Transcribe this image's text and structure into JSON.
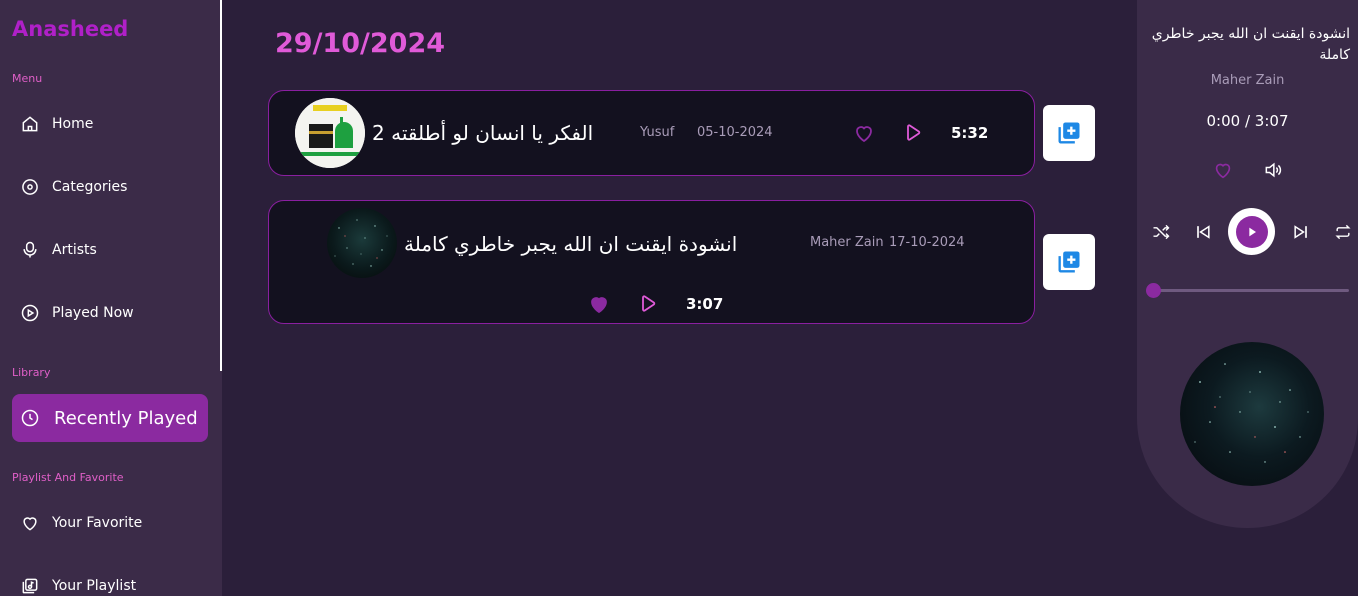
{
  "app": {
    "name": "Anasheed"
  },
  "sidebar": {
    "sections": {
      "menu": "Menu",
      "library": "Library",
      "playlist": "Playlist And Favorite"
    },
    "items": [
      {
        "label": "Home",
        "icon": "home-icon"
      },
      {
        "label": "Categories",
        "icon": "disc-icon"
      },
      {
        "label": "Artists",
        "icon": "microphone-icon"
      },
      {
        "label": "Played Now",
        "icon": "play-circle-icon"
      },
      {
        "label": "Recently Played",
        "icon": "clock-icon",
        "active": true
      },
      {
        "label": "Your Favorite",
        "icon": "heart-icon"
      },
      {
        "label": "Your Playlist",
        "icon": "playlist-icon"
      }
    ]
  },
  "main": {
    "date": "29/10/2024",
    "tracks": [
      {
        "title": "الفكر يا انسان لو أطلقته 2",
        "artist": "Yusuf",
        "date": "05-10-2024",
        "duration": "5:32",
        "liked": false
      },
      {
        "title": "انشودة ايقنت ان الله يجبر خاطري كاملة",
        "artist": "Maher Zain",
        "date": "17-10-2024",
        "duration": "3:07",
        "liked": true
      }
    ]
  },
  "player": {
    "title": "انشودة ايقنت ان الله يجبر خاطري كاملة",
    "artist": "Maher Zain",
    "current_time": "0:00",
    "separator": " / ",
    "total_time": "3:07",
    "progress": 0
  },
  "colors": {
    "accent": "#8b2aa0",
    "pink": "#e05ad8",
    "sidebar": "#3b2b48",
    "background": "#2b1f3a",
    "card": "#13111f",
    "add_button": "#1e88e5"
  }
}
